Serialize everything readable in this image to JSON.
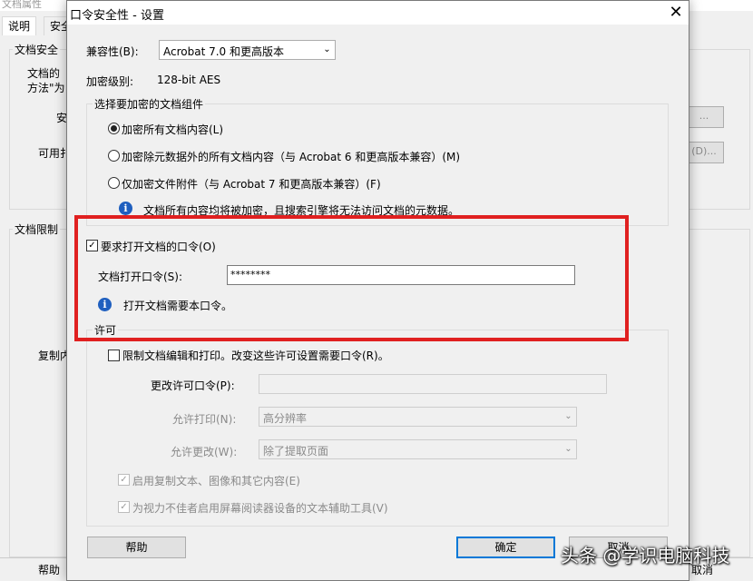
{
  "background_window": {
    "title": "文档属性",
    "tabs": [
      "说明",
      "安全"
    ],
    "section1_title": "文档安全",
    "section1_text_line1": "文档的",
    "section1_text_line2": "方法\"为",
    "label_security": "安",
    "label_available": "可用扌",
    "btn_details1": "...",
    "btn_details2": "(D)...",
    "section2_title": "文档限制",
    "label_copy": "复制内",
    "help_button": "帮助",
    "cancel_button": "取消"
  },
  "dialog": {
    "title": "口令安全性 - 设置",
    "close_glyph": "✕",
    "compat_label": "兼容性(B):",
    "compat_value": "Acrobat 7.0 和更高版本",
    "encryption_label": "加密级别:",
    "encryption_value": "128-bit AES",
    "components_group": {
      "legend": "选择要加密的文档组件",
      "options": [
        {
          "label": "加密所有文档内容(L)",
          "selected": true
        },
        {
          "label": "加密除元数据外的所有文档内容（与 Acrobat 6 和更高版本兼容）(M)",
          "selected": false
        },
        {
          "label": "仅加密文件附件（与 Acrobat 7 和更高版本兼容）(F)",
          "selected": false
        }
      ],
      "info_text": "文档所有内容均将被加密，且搜索引擎将无法访问文档的元数据。"
    },
    "open_password": {
      "checkbox_label": "要求打开文档的口令(O)",
      "checked": true,
      "field_label": "文档打开口令(S):",
      "field_value": "********",
      "info_text": "打开文档需要本口令。"
    },
    "permissions": {
      "legend": "许可",
      "restrict_label": "限制文档编辑和打印。改变这些许可设置需要口令(R)。",
      "restrict_checked": false,
      "change_password_label": "更改许可口令(P):",
      "change_password_value": "",
      "printing_label": "允许打印(N):",
      "printing_value": "高分辨率",
      "changes_label": "允许更改(W):",
      "changes_value": "除了提取页面",
      "enable_copy_label": "启用复制文本、图像和其它内容(E)",
      "enable_copy_checked": true,
      "screen_reader_label": "为视力不佳者启用屏幕阅读器设备的文本辅助工具(V)",
      "screen_reader_checked": true
    },
    "help_button": "帮助",
    "ok_button": "确定",
    "cancel_button": "取消"
  },
  "watermark": "头条 @学识电脑科技",
  "colors": {
    "highlight_border": "#e02020",
    "info_icon": "#1f5fbf",
    "default_button": "#0078d7"
  }
}
